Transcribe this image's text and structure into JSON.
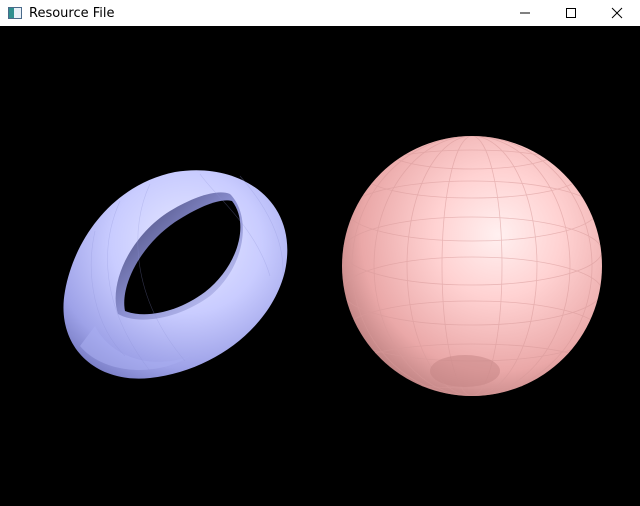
{
  "window": {
    "title": "Resource File",
    "controls": [
      "minimize",
      "maximize",
      "close"
    ]
  },
  "scene": {
    "background": "#000000",
    "objects": [
      {
        "kind": "torus",
        "color": "#c8ccff"
      },
      {
        "kind": "sphere",
        "color": "#ffc8c8"
      }
    ]
  }
}
